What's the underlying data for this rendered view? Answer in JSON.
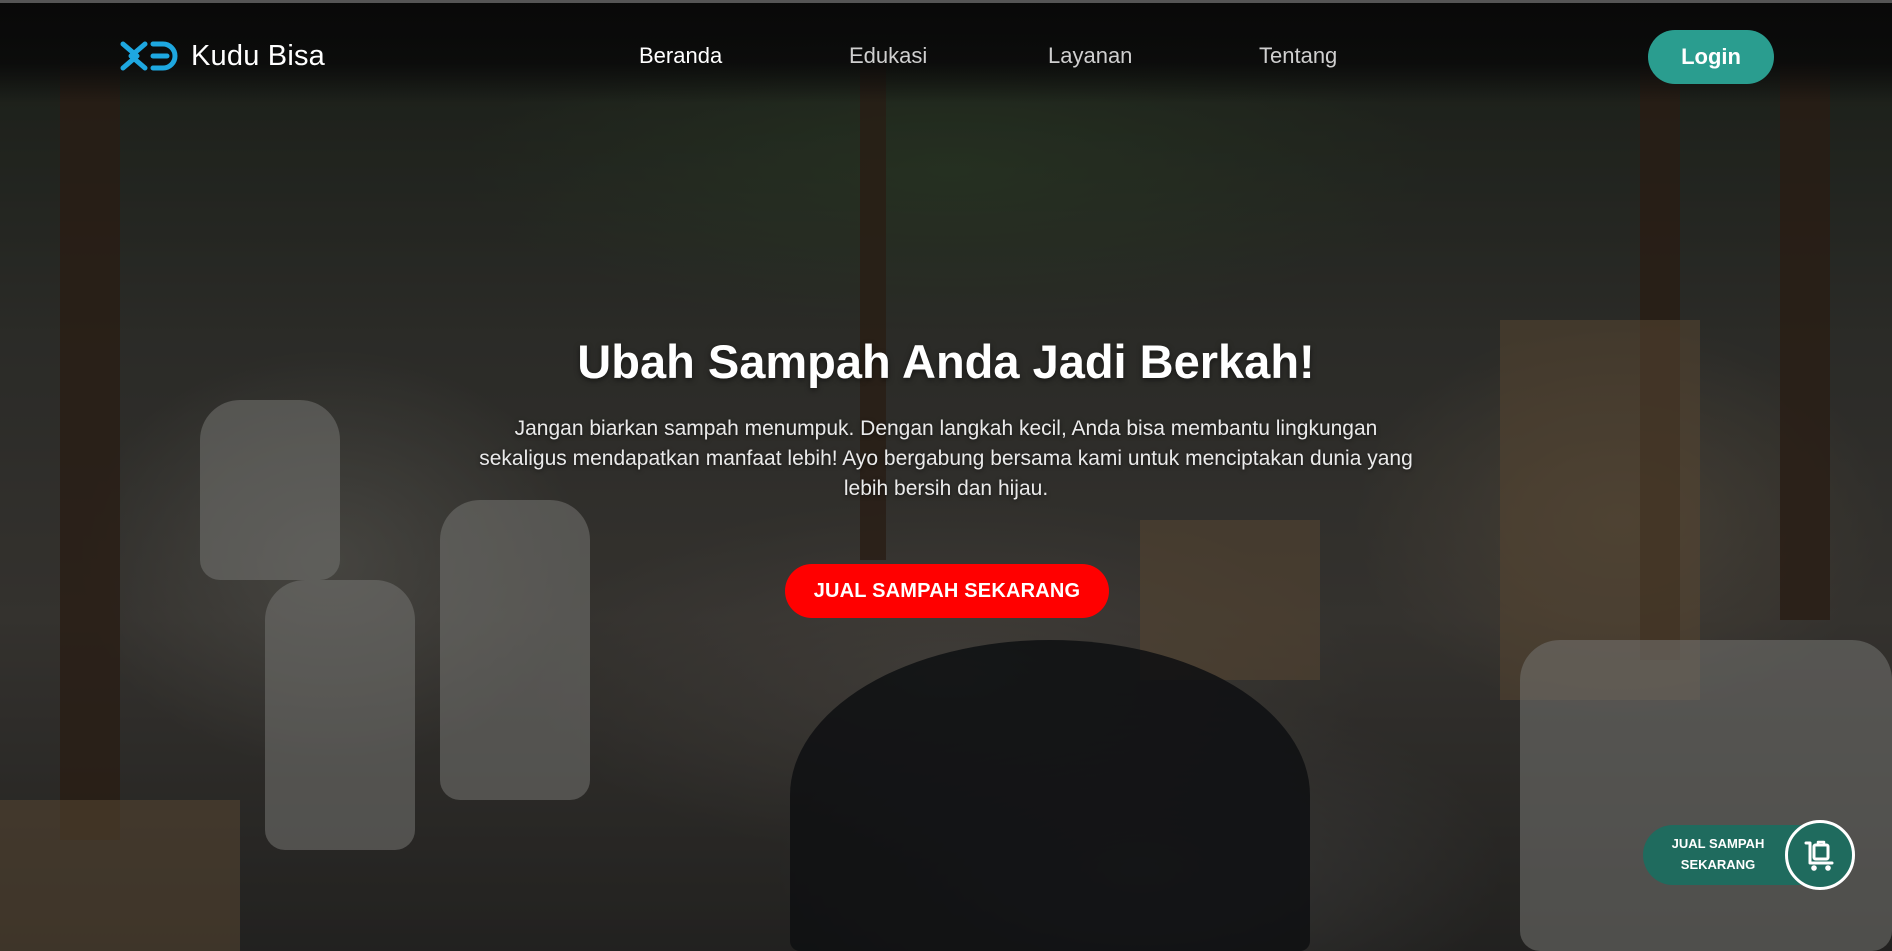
{
  "brand": {
    "name": "Kudu Bisa",
    "logo_icon": "kudu-bisa-logo-icon",
    "accent_color": "#1ea7e0"
  },
  "nav": {
    "items": [
      {
        "label": "Beranda",
        "active": true
      },
      {
        "label": "Edukasi",
        "active": false
      },
      {
        "label": "Layanan",
        "active": false
      },
      {
        "label": "Tentang",
        "active": false
      }
    ],
    "login_label": "Login",
    "login_color": "#2a9d8f"
  },
  "hero": {
    "title": "Ubah Sampah Anda Jadi Berkah!",
    "description": "Jangan biarkan sampah menumpuk. Dengan langkah kecil, Anda bisa membantu lingkungan sekaligus mendapatkan manfaat lebih! Ayo bergabung bersama kami untuk menciptakan dunia yang lebih bersih dan hijau.",
    "cta_label": "JUAL SAMPAH SEKARANG",
    "cta_color": "#ff0000",
    "background": "recycling-warehouse-photo"
  },
  "floating_widget": {
    "label_line1": "JUAL SAMPAH",
    "label_line2": "SEKARANG",
    "icon": "cart-trash-icon",
    "color": "#1f6b5e"
  }
}
